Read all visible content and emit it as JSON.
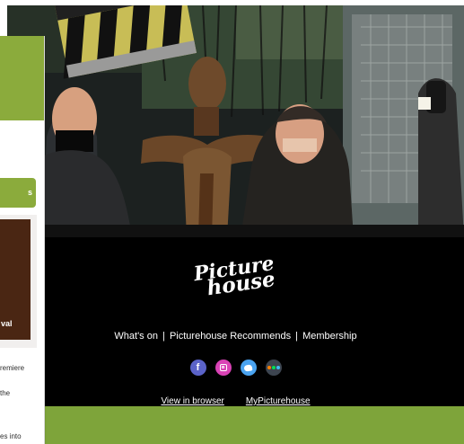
{
  "left_panel": {
    "button_fragment": "s",
    "poster_fragment": "val",
    "snippet_1": "remiere",
    "snippet_2": "the",
    "snippet_3": "es into"
  },
  "footer": {
    "logo_text_line_1": "Picture",
    "logo_text_line_2": "house",
    "nav_whats_on": "What's on",
    "nav_separator": "|",
    "nav_picturehouse_recommends": "Picturehouse Recommends",
    "nav_membership": "Membership",
    "social_icons": [
      "facebook-icon",
      "instagram-icon",
      "twitter-icon",
      "letterboxd-icon"
    ],
    "facebook_glyph": "f",
    "view_in_browser": "View in browser",
    "my_picturehouse": "MyPicturehouse"
  },
  "colors": {
    "brand_green": "#8bab3c",
    "footer_green": "#7ea43a",
    "footer_bg": "#000000",
    "facebook": "#5b63c8",
    "instagram": "#d942b5",
    "twitter": "#4aa3f0",
    "letterboxd": "#3d4550"
  }
}
